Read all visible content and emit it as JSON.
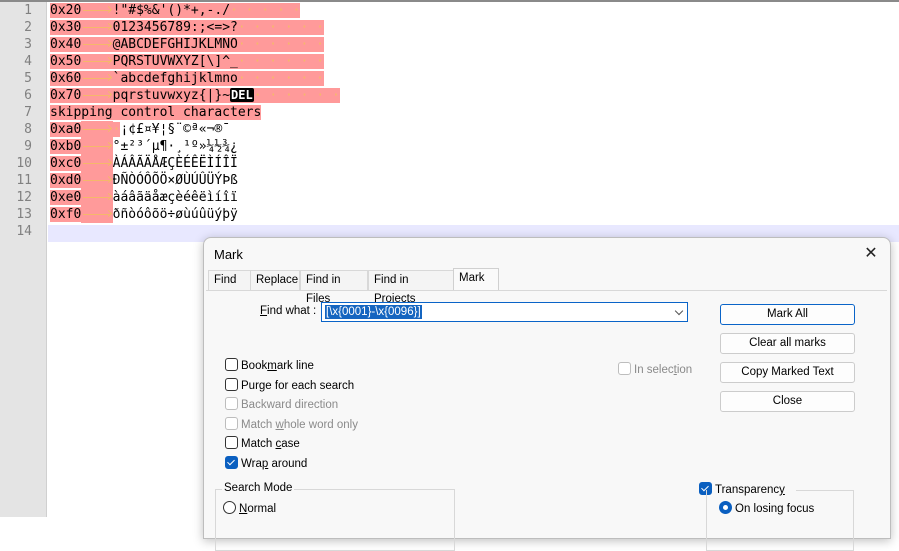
{
  "editor": {
    "lines": [
      {
        "num": "1",
        "hex": "0x20",
        "chars": "!\"#$%&'()*+,-./",
        "trail": "· · · · ·"
      },
      {
        "num": "2",
        "hex": "0x30",
        "chars": "0123456789:;<=>?",
        "trail": "· · · · · ·"
      },
      {
        "num": "3",
        "hex": "0x40",
        "chars": "@ABCDEFGHIJKLMNO",
        "trail": "· · · · · ·"
      },
      {
        "num": "4",
        "hex": "0x50",
        "chars": "PQRSTUVWXYZ[\\]^_",
        "trail": "· · · · · ·"
      },
      {
        "num": "5",
        "hex": "0x60",
        "chars": "`abcdefghijklmno",
        "trail": "· · · · · ·"
      },
      {
        "num": "6",
        "hex": "0x70",
        "chars": "pqrstuvwxyz{|}~",
        "del": "DEL",
        "trail": "· · · · · ·"
      },
      {
        "num": "7",
        "text": "skipping control characters"
      },
      {
        "num": "8",
        "hex": "0xa0",
        "nbsp": "·",
        "chars": "¡¢£¤¥¦§¨©ª«¬®¯"
      },
      {
        "num": "9",
        "hex": "0xb0",
        "chars": "°±²³´µ¶·¸¹º»¼½¾¿"
      },
      {
        "num": "10",
        "hex": "0xc0",
        "chars": "ÀÁÂÃÄÅÆÇÈÉÊËÌÍÎÏ"
      },
      {
        "num": "11",
        "hex": "0xd0",
        "chars": "ÐÑÒÓÔÕÖ×ØÙÚÛÜÝÞß"
      },
      {
        "num": "12",
        "hex": "0xe0",
        "chars": "àáâãäåæçèéêëìíîï"
      },
      {
        "num": "13",
        "hex": "0xf0",
        "chars": "ðñòóôõö÷øùúûüýþÿ"
      },
      {
        "num": "14"
      }
    ]
  },
  "dialog": {
    "title": "Mark",
    "close": "✕",
    "tabs": [
      "Find",
      "Replace",
      "Find in Files",
      "Find in Projects",
      "Mark"
    ],
    "active_tab": "Mark",
    "find_what_label_u": "F",
    "find_what_label_rest": "ind what :",
    "find_what_value": "[\\x{0001}-\\x{0096}]",
    "buttons": {
      "mark_all": "Mark All",
      "clear_all": "Clear all marks",
      "copy_marked": "Copy Marked Text",
      "close": "Close"
    },
    "in_selection": {
      "pre": "In selec",
      "u": "t",
      "post": "ion",
      "checked": false
    },
    "options": [
      {
        "pre": "Book",
        "u": "m",
        "post": "ark line",
        "checked": false,
        "disabled": false
      },
      {
        "pre": "Purge for each search",
        "u": "",
        "post": "",
        "checked": false,
        "disabled": false
      },
      {
        "pre": "Backward direction",
        "u": "",
        "post": "",
        "checked": false,
        "disabled": true
      },
      {
        "pre": "Match ",
        "u": "w",
        "post": "hole word only",
        "checked": false,
        "disabled": true
      },
      {
        "pre": "Match ",
        "u": "c",
        "post": "ase",
        "checked": false,
        "disabled": false
      },
      {
        "pre": "Wra",
        "u": "p",
        "post": " around",
        "checked": true,
        "disabled": false
      }
    ],
    "search_mode": {
      "title": "Search Mode",
      "normal_u": "N",
      "normal_rest": "ormal"
    },
    "transparency": {
      "pre": "Transparenc",
      "u": "y",
      "checked": true,
      "on_losing_focus": "On losing focus"
    }
  }
}
